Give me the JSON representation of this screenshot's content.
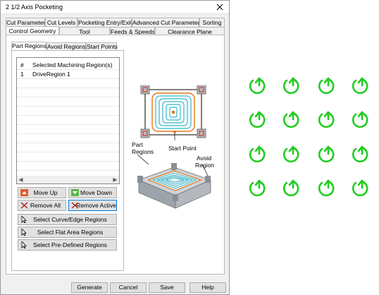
{
  "window": {
    "title": "2 1/2 Axis Pocketing",
    "close_glyph": "✕"
  },
  "tabs_row1": [
    {
      "label": "Cut Parameters"
    },
    {
      "label": "Cut Levels"
    },
    {
      "label": "Pocketing Entry/Exit"
    },
    {
      "label": "Advanced Cut Parameters"
    },
    {
      "label": "Sorting"
    }
  ],
  "tabs_row2": [
    {
      "label": "Control Geometry",
      "active": true
    },
    {
      "label": "Tool"
    },
    {
      "label": "Feeds & Speeds"
    },
    {
      "label": "Clearance Plane"
    }
  ],
  "subtabs": [
    {
      "label": "Part Regions",
      "active": true
    },
    {
      "label": "Avoid Regions"
    },
    {
      "label": "Start Points"
    }
  ],
  "list": {
    "header": {
      "num": "#",
      "name": "Selected Machining Region(s)"
    },
    "rows": [
      {
        "num": "1",
        "name": "DriveRegion 1"
      }
    ]
  },
  "buttons": {
    "move_up": "Move Up",
    "move_down": "Move Down",
    "remove_all": "Remove All",
    "remove_active": "Remove Active",
    "select_curve": "Select Curve/Edge Regions",
    "select_flat": "Select Flat Area Regions",
    "select_predefined": "Select Pre-Defined Regions"
  },
  "diagram": {
    "start_point": "Start Point",
    "part_regions_l1": "Part",
    "part_regions_l2": "Regions",
    "avoid_region_l1": "Avoid",
    "avoid_region_l2": "Region"
  },
  "footer": {
    "generate": "Generate",
    "cancel": "Cancel",
    "save": "Save",
    "help": "Help"
  },
  "icon_grid": {
    "rows": 4,
    "cols": 4,
    "icon": "green-circular-arrow-icon",
    "color": "#22cc22"
  }
}
